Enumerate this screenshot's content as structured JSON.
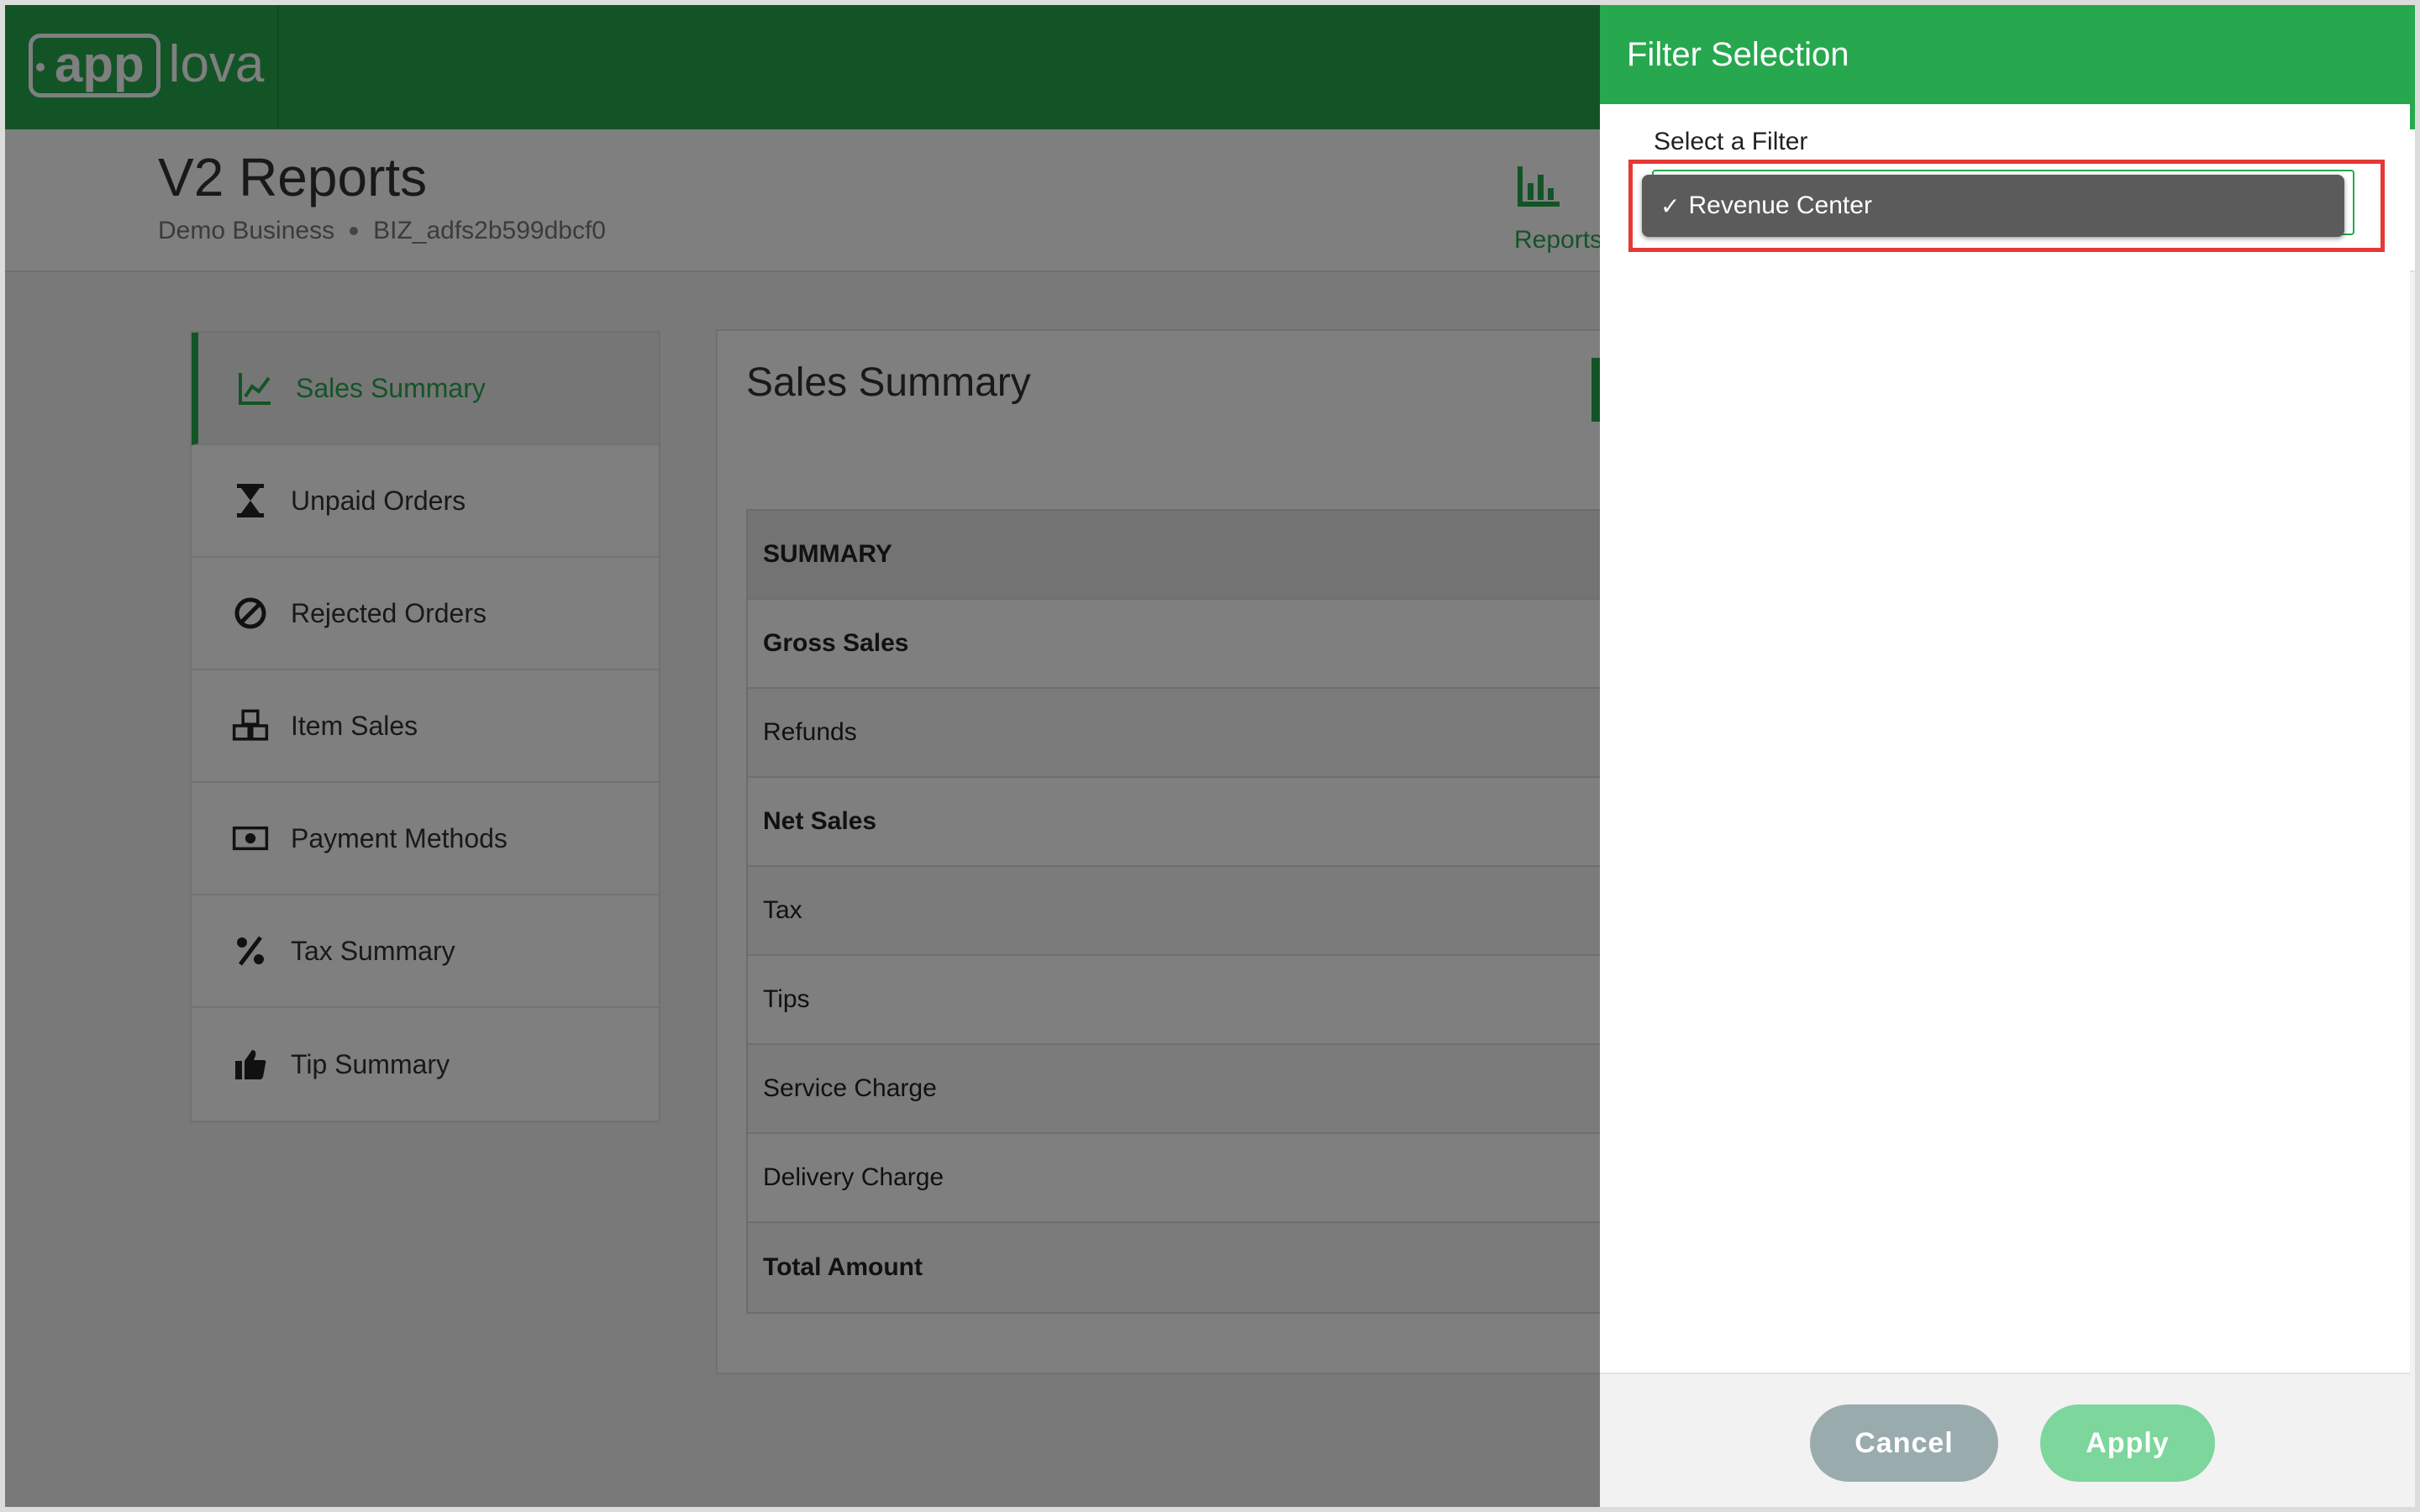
{
  "brand": {
    "logo_box": "app",
    "logo_rest": "lova"
  },
  "header": {
    "title": "V2 Reports",
    "business": "Demo Business",
    "biz_id": "BIZ_adfs2b599dbcf0",
    "reports_label": "Reports"
  },
  "sidebar": {
    "items": [
      {
        "label": "Sales Summary",
        "icon": "chart-line-icon"
      },
      {
        "label": "Unpaid Orders",
        "icon": "hourglass-icon"
      },
      {
        "label": "Rejected Orders",
        "icon": "ban-icon"
      },
      {
        "label": "Item Sales",
        "icon": "boxes-icon"
      },
      {
        "label": "Payment Methods",
        "icon": "money-bill-icon"
      },
      {
        "label": "Tax Summary",
        "icon": "percent-icon"
      },
      {
        "label": "Tip Summary",
        "icon": "thumbs-up-icon"
      }
    ]
  },
  "content": {
    "title": "Sales Summary",
    "table": {
      "header": "SUMMARY",
      "rows": [
        "Gross Sales",
        "Refunds",
        "Net Sales",
        "Tax",
        "Tips",
        "Service Charge",
        "Delivery Charge",
        "Total Amount"
      ]
    }
  },
  "drawer": {
    "title": "Filter Selection",
    "field_label": "Select a Filter",
    "selected_option": "Revenue Center",
    "check_mark": "✓",
    "cancel_label": "Cancel",
    "apply_label": "Apply"
  },
  "colors": {
    "brand_green": "#27a84f",
    "highlight_red": "#e53935"
  }
}
